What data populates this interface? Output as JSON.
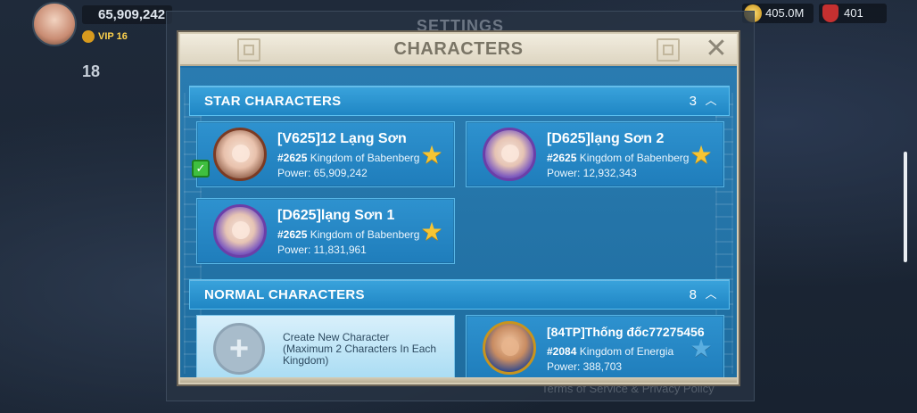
{
  "background": {
    "power": "65,909,242",
    "vip": "VIP 16",
    "left_number": "18",
    "gold": "405.0M",
    "gems": "401",
    "settings_title": "SETTINGS",
    "footer": "Terms of Service & Privacy Policy"
  },
  "dialog": {
    "title": "CHARACTERS",
    "close_icon": "close-icon"
  },
  "star_section": {
    "label": "STAR CHARACTERS",
    "count": "3",
    "characters": [
      {
        "name": "[V625]12 Lạng Sơn",
        "kingdom_id": "#2625",
        "kingdom_name": "Kingdom of Babenberg",
        "power": "Power: 65,909,242",
        "starred": true,
        "current": true
      },
      {
        "name": "[D625]lạng Sơn 2",
        "kingdom_id": "#2625",
        "kingdom_name": "Kingdom of Babenberg",
        "power": "Power: 12,932,343",
        "starred": true,
        "current": false
      },
      {
        "name": "[D625]lạng Sơn 1",
        "kingdom_id": "#2625",
        "kingdom_name": "Kingdom of Babenberg",
        "power": "Power: 11,831,961",
        "starred": true,
        "current": false
      }
    ]
  },
  "normal_section": {
    "label": "NORMAL CHARACTERS",
    "count": "8",
    "create": {
      "line1": "Create New Character",
      "line2": "(Maximum 2 Characters In Each Kingdom)"
    },
    "characters": [
      {
        "name": "[84TP]Thống đốc77275456",
        "kingdom_id": "#2084",
        "kingdom_name": "Kingdom of Energia",
        "power": "Power: 388,703",
        "starred": false
      }
    ]
  },
  "colors": {
    "star_active": "#f7c533",
    "panel_blue": "#2176ad",
    "header_beige": "#ddd5c1"
  }
}
